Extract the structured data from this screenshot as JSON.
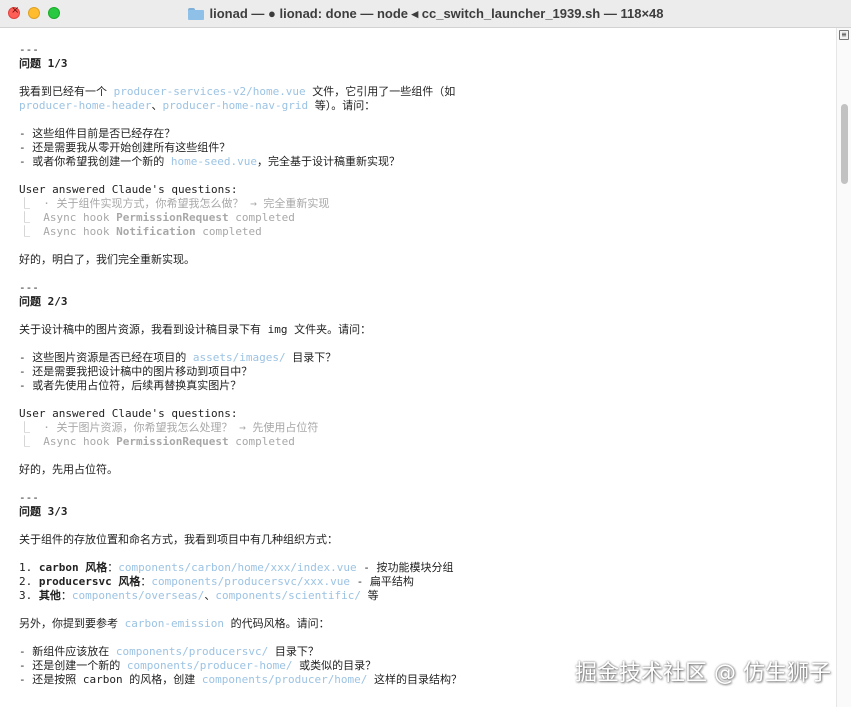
{
  "window": {
    "title": "lionad — ● lionad: done — node ◂ cc_switch_launcher_1939.sh — 118×48",
    "icon": "folder-icon",
    "traffic_lights": {
      "close": "#fe5f57",
      "minimize": "#febc2e",
      "zoom": "#28c840"
    }
  },
  "colors": {
    "path": "#9cc3e3",
    "dim": "#a8a8a8",
    "text": "#222222"
  },
  "lines": [
    [
      {
        "t": "---"
      }
    ],
    [
      {
        "t": "问题 1/3",
        "s": "b"
      }
    ],
    [],
    [
      {
        "t": "我看到已经有一个 "
      },
      {
        "t": "producer-services-v2/home.vue",
        "s": "path"
      },
      {
        "t": " 文件，它引用了一些组件（如"
      }
    ],
    [
      {
        "t": "producer-home-header",
        "s": "path"
      },
      {
        "t": "、"
      },
      {
        "t": "producer-home-nav-grid",
        "s": "path"
      },
      {
        "t": " 等）。请问："
      }
    ],
    [],
    [
      {
        "t": "- 这些组件目前是否已经存在？"
      }
    ],
    [
      {
        "t": "- 还是需要我从零开始创建所有这些组件？"
      }
    ],
    [
      {
        "t": "- 或者你希望我创建一个新的 "
      },
      {
        "t": "home-seed.vue",
        "s": "path"
      },
      {
        "t": "，完全基于设计稿重新实现？"
      }
    ],
    [],
    [
      {
        "t": "User answered Claude's questions:"
      }
    ],
    [
      {
        "t": "⎿  · 关于组件实现方式，你希望我怎么做？ → 完全重新实现",
        "s": "dim"
      }
    ],
    [
      {
        "t": "⎿  Async hook ",
        "s": "dim"
      },
      {
        "t": "PermissionRequest",
        "s": "dimb"
      },
      {
        "t": " completed",
        "s": "dim"
      }
    ],
    [
      {
        "t": "⎿  Async hook ",
        "s": "dim"
      },
      {
        "t": "Notification",
        "s": "dimb"
      },
      {
        "t": " completed",
        "s": "dim"
      }
    ],
    [],
    [
      {
        "t": "好的，明白了，我们完全重新实现。"
      }
    ],
    [],
    [
      {
        "t": "---"
      }
    ],
    [
      {
        "t": "问题 2/3",
        "s": "b"
      }
    ],
    [],
    [
      {
        "t": "关于设计稿中的图片资源，我看到设计稿目录下有 img 文件夹。请问："
      }
    ],
    [],
    [
      {
        "t": "- 这些图片资源是否已经在项目的 "
      },
      {
        "t": "assets/images/",
        "s": "path"
      },
      {
        "t": " 目录下？"
      }
    ],
    [
      {
        "t": "- 还是需要我把设计稿中的图片移动到项目中？"
      }
    ],
    [
      {
        "t": "- 或者先使用占位符，后续再替换真实图片？"
      }
    ],
    [],
    [
      {
        "t": "User answered Claude's questions:"
      }
    ],
    [
      {
        "t": "⎿  · 关于图片资源，你希望我怎么处理？ → 先使用占位符",
        "s": "dim"
      }
    ],
    [
      {
        "t": "⎿  Async hook ",
        "s": "dim"
      },
      {
        "t": "PermissionRequest",
        "s": "dimb"
      },
      {
        "t": " completed",
        "s": "dim"
      }
    ],
    [],
    [
      {
        "t": "好的，先用占位符。"
      }
    ],
    [],
    [
      {
        "t": "---"
      }
    ],
    [
      {
        "t": "问题 3/3",
        "s": "b"
      }
    ],
    [],
    [
      {
        "t": "关于组件的存放位置和命名方式，我看到项目中有几种组织方式："
      }
    ],
    [],
    [
      {
        "t": "1. "
      },
      {
        "t": "carbon 风格",
        "s": "b"
      },
      {
        "t": "："
      },
      {
        "t": "components/carbon/home/xxx/index.vue",
        "s": "path"
      },
      {
        "t": " - 按功能模块分组"
      }
    ],
    [
      {
        "t": "2. "
      },
      {
        "t": "producersvc 风格",
        "s": "b"
      },
      {
        "t": "："
      },
      {
        "t": "components/producersvc/xxx.vue",
        "s": "path"
      },
      {
        "t": " - 扁平结构"
      }
    ],
    [
      {
        "t": "3. "
      },
      {
        "t": "其他",
        "s": "b"
      },
      {
        "t": "："
      },
      {
        "t": "components/overseas/",
        "s": "path"
      },
      {
        "t": "、"
      },
      {
        "t": "components/scientific/",
        "s": "path"
      },
      {
        "t": " 等"
      }
    ],
    [],
    [
      {
        "t": "另外，你提到要参考 "
      },
      {
        "t": "carbon-emission",
        "s": "path"
      },
      {
        "t": " 的代码风格。请问："
      }
    ],
    [],
    [
      {
        "t": "- 新组件应该放在 "
      },
      {
        "t": "components/producersvc/",
        "s": "path"
      },
      {
        "t": " 目录下？"
      }
    ],
    [
      {
        "t": "- 还是创建一个新的 "
      },
      {
        "t": "components/producer-home/",
        "s": "path"
      },
      {
        "t": " 或类似的目录？"
      }
    ],
    [
      {
        "t": "- 还是按照 carbon 的风格，创建 "
      },
      {
        "t": "components/producer/home/",
        "s": "path"
      },
      {
        "t": " 这样的目录结构？"
      }
    ]
  ],
  "watermark": "掘金技术社区 @ 仿生狮子"
}
